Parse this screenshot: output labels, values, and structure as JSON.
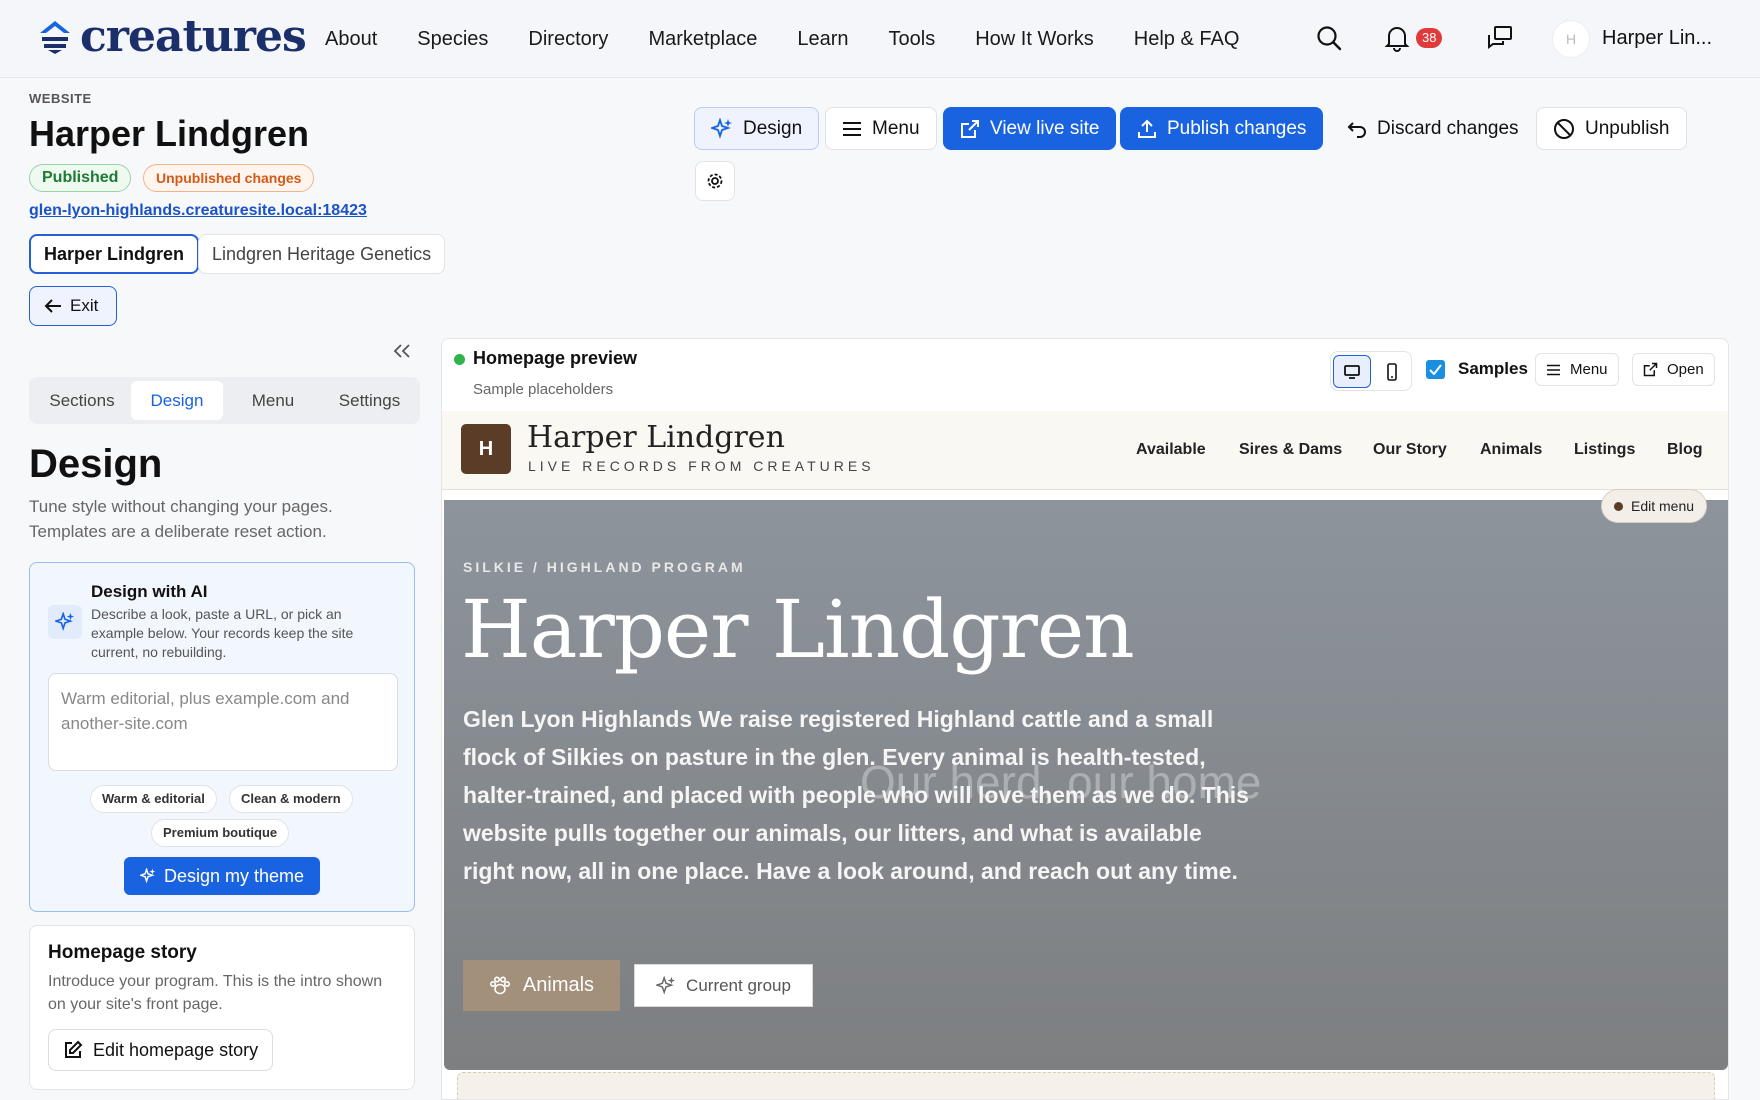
{
  "brand": {
    "name": "creatures",
    "color": "#1b2f6b"
  },
  "nav": {
    "links": [
      "About",
      "Species",
      "Directory",
      "Marketplace",
      "Learn",
      "Tools",
      "How It Works",
      "Help & FAQ"
    ],
    "notification_count": "38",
    "avatar_initial": "H",
    "user_name": "Harper Lin..."
  },
  "header": {
    "eyebrow": "WEBSITE",
    "title": "Harper Lindgren",
    "status_published": "Published",
    "status_unpublished": "Unpublished changes",
    "url": "glen-lyon-highlands.creaturesite.local:18423",
    "site_tabs": [
      "Harper Lindgren",
      "Lindgren Heritage Genetics"
    ],
    "exit_label": "Exit"
  },
  "toolbar": {
    "design": "Design",
    "menu": "Menu",
    "view_live": "View live site",
    "publish": "Publish changes",
    "discard": "Discard changes",
    "unpublish": "Unpublish"
  },
  "panel": {
    "tabs": [
      "Sections",
      "Design",
      "Menu",
      "Settings"
    ],
    "active_tab": "Design",
    "title": "Design",
    "description": "Tune style without changing your pages. Templates are a deliberate reset action.",
    "ai": {
      "title": "Design with AI",
      "description": "Describe a look, paste a URL, or pick an example below. Your records keep the site current, no rebuilding.",
      "placeholder": "Warm editorial, plus example.com and another-site.com",
      "chips": [
        "Warm & editorial",
        "Clean & modern",
        "Premium boutique"
      ],
      "button": "Design my theme"
    },
    "story": {
      "title": "Homepage story",
      "description": "Introduce your program. This is the intro shown on your site's front page.",
      "button": "Edit homepage story"
    }
  },
  "preview": {
    "title": "Homepage preview",
    "subtitle": "Sample placeholders",
    "samples_label": "Samples",
    "menu_label": "Menu",
    "open_label": "Open",
    "site": {
      "logo_initial": "H",
      "name": "Harper Lindgren",
      "tagline": "LIVE RECORDS FROM CREATURES",
      "nav": [
        "Available",
        "Sires & Dams",
        "Our Story",
        "Animals",
        "Listings",
        "Blog"
      ],
      "edit_menu": "Edit menu",
      "hero_eyebrow": "SILKIE / HIGHLAND PROGRAM",
      "hero_title": "Harper Lindgren",
      "hero_body": "Glen Lyon Highlands We raise registered Highland cattle and a small flock of Silkies on pasture in the glen. Every animal is health-tested, halter-trained, and placed with people who will love them as we do. This website pulls together our animals, our litters, and what is available right now, all in one place. Have a look around, and reach out any time.",
      "hero_ghost": "Our herd, our home",
      "hero_btn_primary": "Animals",
      "hero_btn_secondary": "Current group"
    }
  },
  "colors": {
    "primary": "#1a63e0",
    "published": "#1c7a35",
    "unpublished": "#d35a18",
    "site_brown": "#5b3d27"
  }
}
